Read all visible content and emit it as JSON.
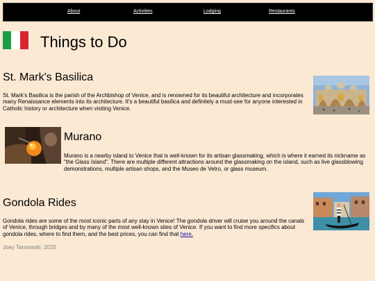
{
  "nav": {
    "items": [
      {
        "label": "About"
      },
      {
        "label": "Activities"
      },
      {
        "label": "Lodging"
      },
      {
        "label": "Restaurants"
      }
    ]
  },
  "header": {
    "title": "Things to Do"
  },
  "sections": {
    "basilica": {
      "title": "St. Mark's Basilica",
      "text": "St. Mark's Basilica is the parish of the Archbishop of Venice, and is renowned for its beautiful architecture and incorporates many Renaissance elements into its architecture. It's a beautiful basilica and definitely a must-see for anyone interested in Catholic history or architecture when visiting Venice."
    },
    "murano": {
      "title": "Murano",
      "text": "Murano is a nearby island to Venice that is well-known for its artisan glassmaking, which is where it earned its nickname as \"the Glass Island\". There are multiple different attractions around the glassmaking on the island, such as live glassblowing demonstrations, multiple artisan shops, and the Museo de Vetro, or glass museum."
    },
    "gondola": {
      "title": "Gondola Rides",
      "text": "Gondola rides are some of the most iconic parts of any stay in Venice! The gondola driver will cruise you around the canals of Venice, through bridges and by many of the most well-known sites of Venice. If you want to find more specifics about gondola rides, where to find them, and the best prices, you can find that ",
      "link_label": "here."
    }
  },
  "footer": {
    "text": "Joey Tarnowski, 2020"
  }
}
